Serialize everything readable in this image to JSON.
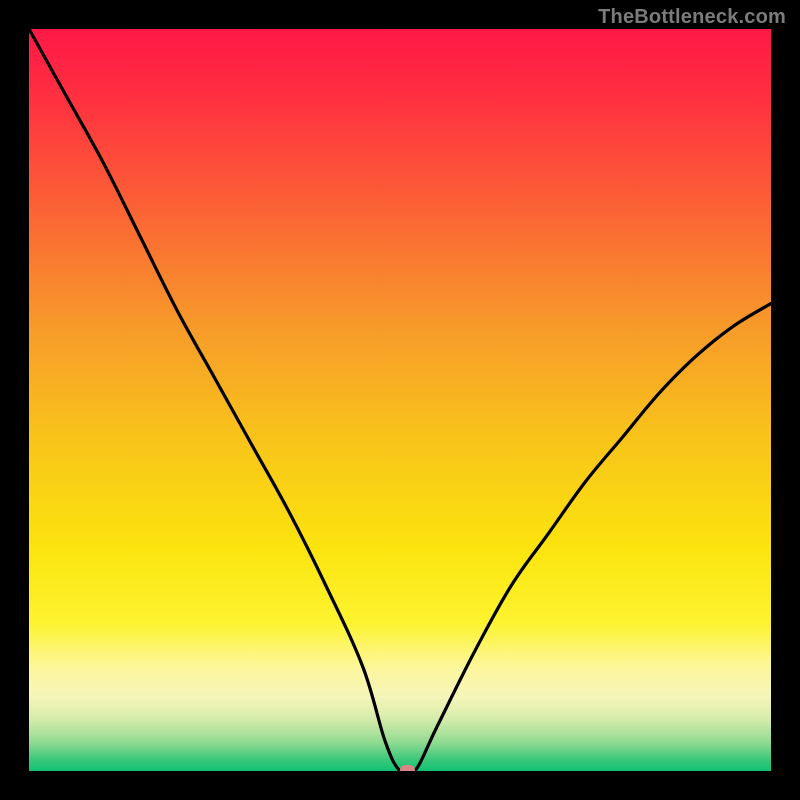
{
  "watermark": "TheBottleneck.com",
  "chart_data": {
    "type": "line",
    "title": "",
    "xlabel": "",
    "ylabel": "",
    "xlim": [
      0,
      100
    ],
    "ylim": [
      0,
      100
    ],
    "grid": false,
    "background": "vertical-gradient red-orange-yellow-green",
    "series": [
      {
        "name": "bottleneck-curve",
        "x": [
          0,
          5,
          10,
          15,
          20,
          25,
          30,
          35,
          40,
          45,
          48,
          50,
          52,
          55,
          60,
          65,
          70,
          75,
          80,
          85,
          90,
          95,
          100
        ],
        "y": [
          100,
          91,
          82,
          72,
          62,
          53,
          44,
          35,
          25,
          14,
          4,
          0,
          0,
          6,
          16,
          25,
          32,
          39,
          45,
          51,
          56,
          60,
          63
        ]
      }
    ],
    "marker": {
      "x": 51,
      "y": 0,
      "shape": "square",
      "color": "#d98586"
    },
    "gradient_stops": [
      {
        "pos": 0.0,
        "color": "#ff1846"
      },
      {
        "pos": 0.1,
        "color": "#ff3240"
      },
      {
        "pos": 0.25,
        "color": "#fb6534"
      },
      {
        "pos": 0.4,
        "color": "#f79a2a"
      },
      {
        "pos": 0.55,
        "color": "#f8c31a"
      },
      {
        "pos": 0.7,
        "color": "#fbe40e"
      },
      {
        "pos": 0.8,
        "color": "#fdf32f"
      },
      {
        "pos": 0.86,
        "color": "#fdf79b"
      },
      {
        "pos": 0.9,
        "color": "#f6f5b9"
      },
      {
        "pos": 0.93,
        "color": "#d5ecaa"
      },
      {
        "pos": 0.96,
        "color": "#94db93"
      },
      {
        "pos": 0.985,
        "color": "#3ac87b"
      },
      {
        "pos": 1.0,
        "color": "#11c171"
      }
    ]
  }
}
